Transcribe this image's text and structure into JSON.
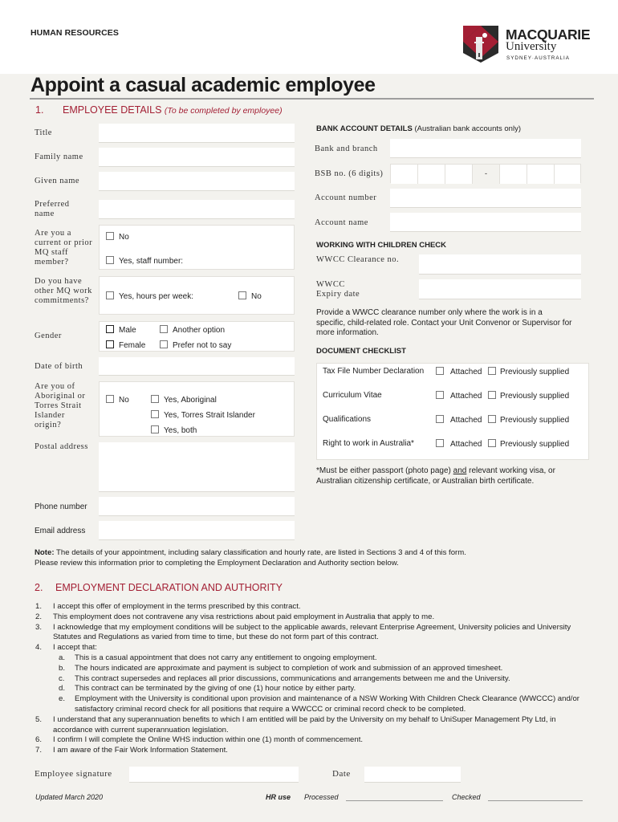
{
  "header": {
    "department": "HUMAN RESOURCES",
    "logo": {
      "name": "MACQUARIE",
      "sub": "University",
      "tagline": "SYDNEY·AUSTRALIA",
      "colors": {
        "red": "#a31f34",
        "dark": "#2b2b2b"
      }
    }
  },
  "title": "Appoint a casual academic employee",
  "accent_color": "#a31f34",
  "section1": {
    "number": "1.",
    "heading": "EMPLOYEE DETAILS",
    "note": "(To be completed by employee)",
    "fields": {
      "title": "Title",
      "family_name": "Family name",
      "given_name": "Given name",
      "preferred_name": "Preferred name",
      "mq_staff": "Are you a current or prior MQ staff member?",
      "mq_staff_options": [
        "No",
        "Yes, staff number:"
      ],
      "other_commitments": "Do you have other MQ work commitments?",
      "other_commitments_options": [
        "Yes, hours per week:",
        "No"
      ],
      "gender": "Gender",
      "gender_options": [
        "Male",
        "Another option",
        "Female",
        "Prefer not to say"
      ],
      "dob": "Date of birth",
      "aboriginal": "Are you of Aboriginal or Torres Strait Islander origin?",
      "aboriginal_options": [
        "No",
        "Yes, Aboriginal",
        "Yes, Torres Strait Islander",
        "Yes, both"
      ],
      "postal_address": "Postal address",
      "phone": "Phone number",
      "email": "Email address"
    },
    "bank": {
      "heading": "BANK ACCOUNT DETAILS",
      "heading_note": "(Australian bank accounts only)",
      "bank_branch": "Bank and branch",
      "bsb": "BSB no. (6 digits)",
      "bsb_separator": "-",
      "account_number": "Account number",
      "account_name": "Account name"
    },
    "wwcc": {
      "heading": "WORKING WITH CHILDREN CHECK",
      "clearance": "WWCC Clearance no.",
      "expiry_line1": "WWCC",
      "expiry_line2": "Expiry date",
      "info": "Provide a WWCC clearance number only where the work is in a specific, child-related role. Contact your Unit Convenor or Supervisor for more information."
    },
    "checklist": {
      "heading": "DOCUMENT CHECKLIST",
      "attached_label": "Attached",
      "previous_label": "Previously supplied",
      "items": [
        "Tax File Number Declaration",
        "Curriculum Vitae",
        "Qualifications",
        "Right to work in Australia*"
      ],
      "footnote_pre": "*Must be either passport (photo page) ",
      "footnote_and": "and",
      "footnote_post": " relevant working visa, or Australian citizenship certificate, or Australian birth certificate."
    },
    "note_bold": "Note:",
    "note_text": " The details of your appointment, including salary classification and hourly rate, are listed in Sections 3 and 4 of this form.",
    "note_line2": "Please review this information prior to completing the Employment Declaration and Authority section below."
  },
  "section2": {
    "number": "2.",
    "heading": "EMPLOYMENT DECLARATION AND AUTHORITY",
    "items": [
      {
        "n": "1.",
        "text": "I accept this offer of employment in the terms prescribed by this contract."
      },
      {
        "n": "2.",
        "text": "This employment does not contravene any visa restrictions about paid employment in Australia that apply to me."
      },
      {
        "n": "3.",
        "text": "I acknowledge that my employment conditions will be subject to the applicable awards, relevant Enterprise Agreement, University policies and University Statutes and Regulations as varied from time to time, but these do not form part of this contract."
      },
      {
        "n": "4.",
        "text": "I accept that:"
      }
    ],
    "sub_items": [
      {
        "n": "a.",
        "text": "This is a casual appointment that does not carry any entitlement to ongoing employment."
      },
      {
        "n": "b.",
        "text": "The hours indicated are approximate and payment is subject to completion of work and submission of an approved timesheet."
      },
      {
        "n": "c.",
        "text": "This contract supersedes and replaces all prior discussions, communications and arrangements between me and the University."
      },
      {
        "n": "d.",
        "text": "This contract can be terminated by the giving of one (1) hour notice by either party."
      },
      {
        "n": "e.",
        "text": "Employment with the University is conditional upon provision and maintenance of a NSW Working With Children Check Clearance (WWCCC) and/or satisfactory criminal record check for all positions that require a WWCCC or criminal record check to be completed."
      }
    ],
    "items_after": [
      {
        "n": "5.",
        "text": "I understand that any superannuation benefits to which I am entitled will be paid by the University on my behalf to UniSuper Management Pty Ltd, in accordance with current superannuation legislation."
      },
      {
        "n": "6.",
        "text": "I confirm I will complete the Online WHS induction within one (1) month of commencement."
      },
      {
        "n": "7.",
        "text": "I am aware of the Fair Work Information Statement."
      }
    ],
    "signature_label": "Employee signature",
    "date_label": "Date"
  },
  "footer": {
    "updated": "Updated March 2020",
    "hr_use": "HR use",
    "processed": "Processed",
    "checked": "Checked"
  }
}
